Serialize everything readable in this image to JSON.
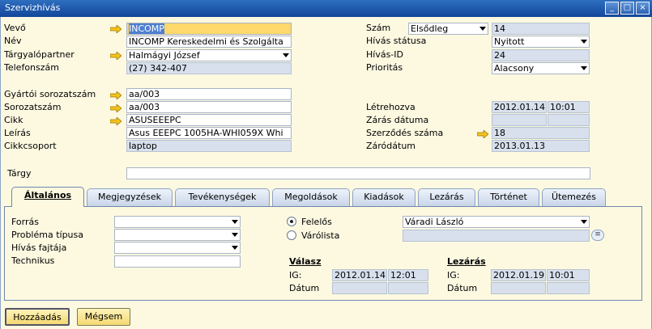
{
  "window": {
    "title": "Szervizhívás",
    "minimize": "_",
    "maximize": "□",
    "close": "×"
  },
  "left": {
    "vevo_label": "Vevő",
    "vevo_value": "INCOMP",
    "nev_label": "Név",
    "nev_value": "INCOMP Kereskedelmi és Szolgálta",
    "targyalo_label": "Tárgyalópartner",
    "targyalo_value": "Halmágyi József",
    "telefon_label": "Telefonszám",
    "telefon_value": "(27) 342-407",
    "gyartoi_label": "Gyártói sorozatszám",
    "gyartoi_value": "aa/003",
    "sorozat_label": "Sorozatszám",
    "sorozat_value": "aa/003",
    "cikk_label": "Cikk",
    "cikk_value": "ASUSEEEPC",
    "leiras_label": "Leírás",
    "leiras_value": "Asus EEEPC 1005HA-WHI059X Whi",
    "cikkcsoport_label": "Cikkcsoport",
    "cikkcsoport_value": "laptop",
    "targy_label": "Tárgy",
    "targy_value": ""
  },
  "right": {
    "szam_label": "Szám",
    "szam_series": "Elsődleg",
    "szam_value": "14",
    "statusz_label": "Hívás státusa",
    "statusz_value": "Nyitott",
    "hivasid_label": "Hívás-ID",
    "hivasid_value": "24",
    "prioritas_label": "Prioritás",
    "prioritas_value": "Alacsony",
    "letrehozva_label": "Létrehozva",
    "letrehozva_date": "2012.01.14",
    "letrehozva_time": "10:01",
    "zaras_label": "Zárás dátuma",
    "zaras_date": "",
    "zaras_time": "",
    "szerzodes_label": "Szerződés száma",
    "szerzodes_value": "18",
    "zarodatum_label": "Záródátum",
    "zarodatum_value": "2013.01.13"
  },
  "tabs": [
    "Általános",
    "Megjegyzések",
    "Tevékenységek",
    "Megoldások",
    "Kiadások",
    "Lezárás",
    "Történet",
    "Ütemezés"
  ],
  "general": {
    "forras_label": "Forrás",
    "forras_value": "",
    "problema_label": "Probléma típusa",
    "problema_value": "",
    "fajta_label": "Hívás fajtája",
    "fajta_value": "",
    "technikus_label": "Technikus",
    "technikus_value": "",
    "felelos_label": "Felelős",
    "felelos_value": "Váradi László",
    "varolista_label": "Várólista",
    "varolista_value": "",
    "valasz_header": "Válasz",
    "valasz_ig_label": "IG:",
    "valasz_ig_date": "2012.01.14",
    "valasz_ig_time": "12:01",
    "valasz_datum_label": "Dátum",
    "lezaras_header": "Lezárás",
    "lezaras_ig_label": "IG:",
    "lezaras_ig_date": "2012.01.19",
    "lezaras_ig_time": "10:01",
    "lezaras_datum_label": "Dátum"
  },
  "buttons": {
    "add": "Hozzáadás",
    "cancel": "Mégsem"
  }
}
